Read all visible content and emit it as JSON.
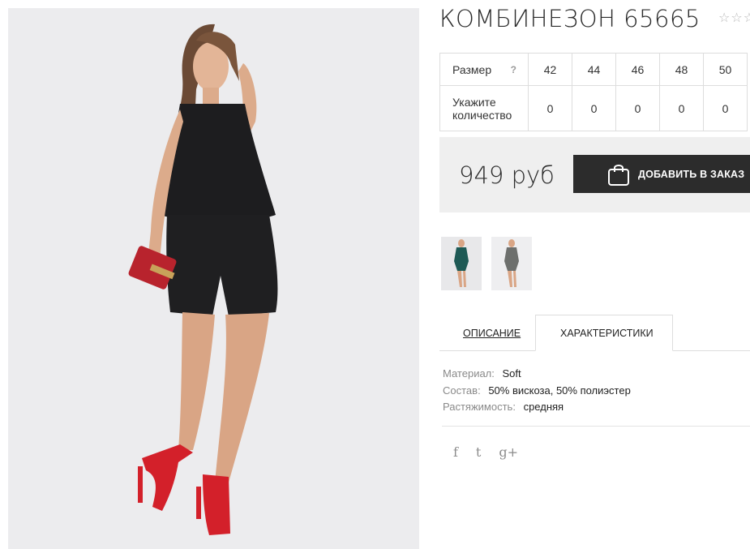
{
  "product": {
    "title": "КОМБИНЕЗОН 65665",
    "rating_stars": "☆☆☆"
  },
  "size_table": {
    "size_label": "Размер",
    "help": "?",
    "sizes": [
      "42",
      "44",
      "46",
      "48",
      "50"
    ],
    "qty_label_line1": "Укажите",
    "qty_label_line2": "количество",
    "quantities": [
      "0",
      "0",
      "0",
      "0",
      "0"
    ]
  },
  "buy": {
    "price": "949 руб",
    "add_label": "ДОБАВИТЬ В ЗАКАЗ",
    "icon": "shopping-bag-icon"
  },
  "tabs": {
    "description": "ОПИСАНИЕ",
    "characteristics": "ХАРАКТЕРИСТИКИ",
    "active": "characteristics"
  },
  "characteristics": [
    {
      "key": "Материал:",
      "value": "Soft"
    },
    {
      "key": "Состав:",
      "value": "50% вискоза, 50% полиэстер"
    },
    {
      "key": "Растяжимость:",
      "value": "средняя"
    }
  ],
  "social": {
    "facebook": "f",
    "twitter": "t",
    "googleplus": "g+"
  },
  "colors": {
    "button_bg": "#2c2c2c",
    "buybox_bg": "#efefef",
    "photo_bg": "#ececee",
    "shoe_red": "#d3202a",
    "dress_black": "#1d1d1f"
  }
}
